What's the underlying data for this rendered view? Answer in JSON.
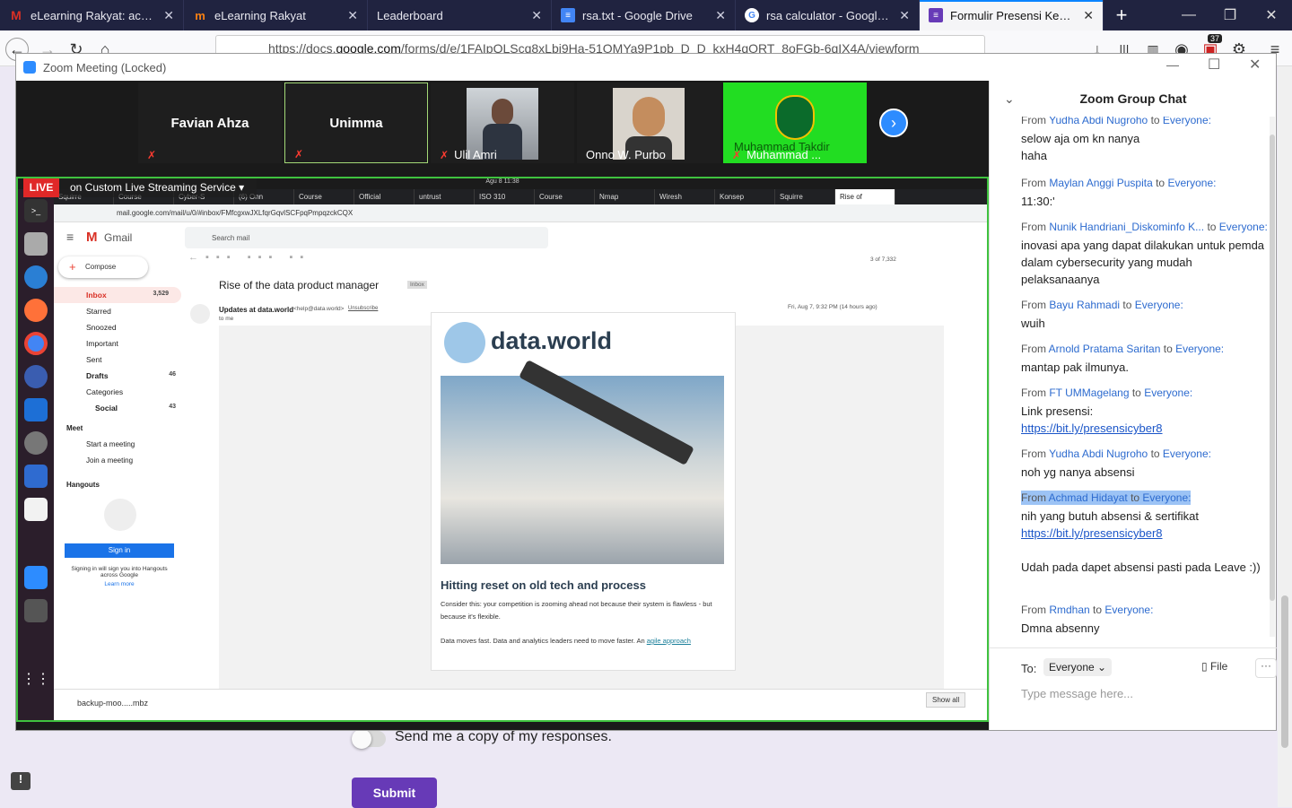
{
  "firefox": {
    "tabs": [
      {
        "label": "eLearning Rakyat: account",
        "icon": "gmail-icon",
        "color": "#d93025"
      },
      {
        "label": "eLearning Rakyat",
        "icon": "moodle-icon",
        "color": "#f98012"
      },
      {
        "label": "Leaderboard",
        "icon": "",
        "color": ""
      },
      {
        "label": "rsa.txt - Google Drive",
        "icon": "docs-icon",
        "color": "#4285f4"
      },
      {
        "label": "rsa calculator - Google Sea",
        "icon": "google-icon",
        "color": "#fff"
      },
      {
        "label": "Formulir Presensi Kehadiran",
        "icon": "forms-icon",
        "color": "#673ab7"
      }
    ],
    "url_prefix": "https://docs.",
    "url_domain": "google.com",
    "url_rest": "/forms/d/e/1FAIpQLScq8xLbi9Ha-51OMYa9P1pb_D_D_kxH4qORT_8oFGb-6qIX4A/viewform",
    "badge": "37"
  },
  "zoom": {
    "title": "Zoom Meeting (Locked)",
    "participants": [
      {
        "name": "Favian Ahza",
        "label": ""
      },
      {
        "name": "Unimma",
        "label": ""
      },
      {
        "name": "",
        "label": "Ulil Amri"
      },
      {
        "name": "",
        "label": "Onno W. Purbo"
      },
      {
        "name": "",
        "label": "Muhammad ..."
      }
    ],
    "overlay_name": "Muhammad Takdir",
    "live_label": "LIVE",
    "live_service": "on Custom Live Streaming Service",
    "colors": {
      "active_speaker": "#a3d977",
      "live_red": "#e02828",
      "share_border": "#3fc23f"
    }
  },
  "shared": {
    "clock": "Agu 8  11:38",
    "chrome_tabs": [
      "Squirre",
      "Course",
      "Cyber-S",
      "(6) Onn",
      "Course",
      "Official",
      "untrust",
      "ISO 310",
      "Course",
      "Nmap",
      "Wiresh",
      "Konsep",
      "Squirre",
      "Rise of"
    ],
    "address": "mail.google.com/mail/u/0/#inbox/FMfcgxwJXLfqrGqvlSCFpqPmpqzckCQX",
    "gmail": {
      "brand": "Gmail",
      "search": "Search mail",
      "compose": "Compose",
      "nav": [
        {
          "label": "Inbox",
          "count": "3,529"
        },
        {
          "label": "Starred",
          "count": ""
        },
        {
          "label": "Snoozed",
          "count": ""
        },
        {
          "label": "Important",
          "count": ""
        },
        {
          "label": "Sent",
          "count": ""
        },
        {
          "label": "Drafts",
          "count": "46"
        },
        {
          "label": "Categories",
          "count": ""
        },
        {
          "label": "Social",
          "count": "43"
        }
      ],
      "meet_title": "Meet",
      "meet_items": [
        "Start a meeting",
        "Join a meeting"
      ],
      "hangouts_title": "Hangouts",
      "sign_in": "Sign in",
      "hangouts_note": "Signing in will sign you into Hangouts across Google",
      "learn_more": "Learn more",
      "pager": "3 of 7,332",
      "subject": "Rise of the data product manager",
      "inbox_tag": "Inbox",
      "sender": "Updates at data.world",
      "sender_email": "<help@data.world>",
      "unsubscribe": "Unsubscribe",
      "to_me": "to me",
      "date": "Fri, Aug 7, 9:32 PM (14 hours ago)",
      "logo_text": "data.world",
      "headline": "Hitting reset on old tech and process",
      "para1": "Consider this: your competition is zooming ahead not because their system is flawless - but because it's flexible.",
      "para2": "Data moves fast. Data and analytics leaders need to move faster. An",
      "para2_link": "agile approach",
      "download": "backup-moo.....mbz",
      "show_all": "Show all"
    }
  },
  "chat": {
    "title": "Zoom Group Chat",
    "to_label": "To:",
    "recipient": "Everyone",
    "file_label": "File",
    "placeholder": "Type message here...",
    "messages": [
      {
        "from": "Yudha Abdi Nugroho",
        "to": "Everyone:",
        "lines": [
          "selow aja om kn nanya",
          "haha"
        ]
      },
      {
        "from": "Maylan Anggi Puspita",
        "to": "Everyone:",
        "lines": [
          "11:30:'"
        ]
      },
      {
        "from": "Nunik Handriani_Diskominfo K...",
        "to": "Everyone:",
        "lines": [
          "inovasi apa yang dapat dilakukan untuk pemda dalam cybersecurity yang mudah pelaksanaanya"
        ]
      },
      {
        "from": "Bayu Rahmadi",
        "to": "Everyone:",
        "lines": [
          "wuih"
        ]
      },
      {
        "from": "Arnold Pratama Saritan",
        "to": "Everyone:",
        "lines": [
          "mantap pak ilmunya."
        ]
      },
      {
        "from": "FT UMMagelang",
        "to": "Everyone:",
        "lines": [
          "Link presensi:"
        ],
        "link": "https://bit.ly/presensicyber8"
      },
      {
        "from": "Yudha Abdi Nugroho",
        "to": "Everyone:",
        "lines": [
          "noh yg nanya absensi"
        ]
      },
      {
        "from": "Achmad Hidayat",
        "to": "Everyone:",
        "lines": [
          "nih yang butuh absensi & sertifikat"
        ],
        "link": "https://bit.ly/presensicyber8",
        "extra": "Udah pada dapet absensi pasti pada Leave :))"
      },
      {
        "from": "Rmdhan",
        "to": "Everyone:",
        "lines": [
          "Dmna absenny"
        ]
      }
    ],
    "from_word": "From",
    "to_word": "to"
  },
  "form": {
    "copy_label": "Send me a copy of my responses.",
    "submit": "Submit"
  }
}
